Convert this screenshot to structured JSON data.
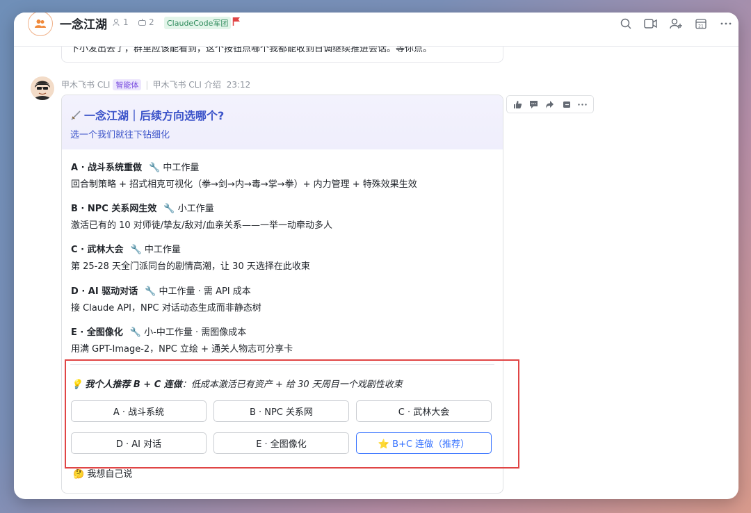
{
  "header": {
    "group_name": "一念江湖",
    "member_count": "1",
    "bot_count": "2",
    "tag": "ClaudeCode军团"
  },
  "prev_message": "下小发出去了，群里应该能看到，这个按钮点哪个我都能收到日调继续推进会话。等你点。",
  "sender": {
    "name": "甲木飞书 CLI",
    "badge": "智能体",
    "description": "甲木飞书 CLI 介绍",
    "time": "23:12"
  },
  "card": {
    "title": "一念江湖｜后续方向选哪个?",
    "subtitle": "选一个我们就往下钻细化",
    "options": [
      {
        "name": "A · 战斗系统重做",
        "effort": "🔧 中工作量",
        "desc": "回合制策略 + 招式相克可视化（拳→剑→内→毒→掌→拳）+ 内力管理 + 特殊效果生效"
      },
      {
        "name": "B · NPC 关系网生效",
        "effort": "🔧 小工作量",
        "desc": "激活已有的 10 对师徒/挚友/敌对/血亲关系——一举一动牵动多人"
      },
      {
        "name": "C · 武林大会",
        "effort": "🔧 中工作量",
        "desc": "第 25-28 天全门派同台的剧情高潮，让 30 天选择在此收束"
      },
      {
        "name": "D · AI 驱动对话",
        "effort": "🔧 中工作量 · 需 API 成本",
        "desc": "接 Claude API，NPC 对话动态生成而非静态树"
      },
      {
        "name": "E · 全图像化",
        "effort": "🔧 小-中工作量 · 需图像成本",
        "desc": "用满 GPT-Image-2，NPC 立绘 + 通关人物志可分享卡"
      }
    ],
    "recommendation_bold": "我个人推荐 B + C 连做",
    "recommendation_rest": "：低成本激活已有资产 + 给 30 天周目一个戏剧性收束",
    "buttons": [
      "A · 战斗系统",
      "B · NPC 关系网",
      "C · 武林大会",
      "D · AI 对话",
      "E · 全图像化",
      "⭐ B+C 连做（推荐）"
    ],
    "self_say": "🤔 我想自己说"
  },
  "colors": {
    "accent": "#3370ff",
    "title_blue": "#3b53c9",
    "highlight_red": "#e04545"
  }
}
